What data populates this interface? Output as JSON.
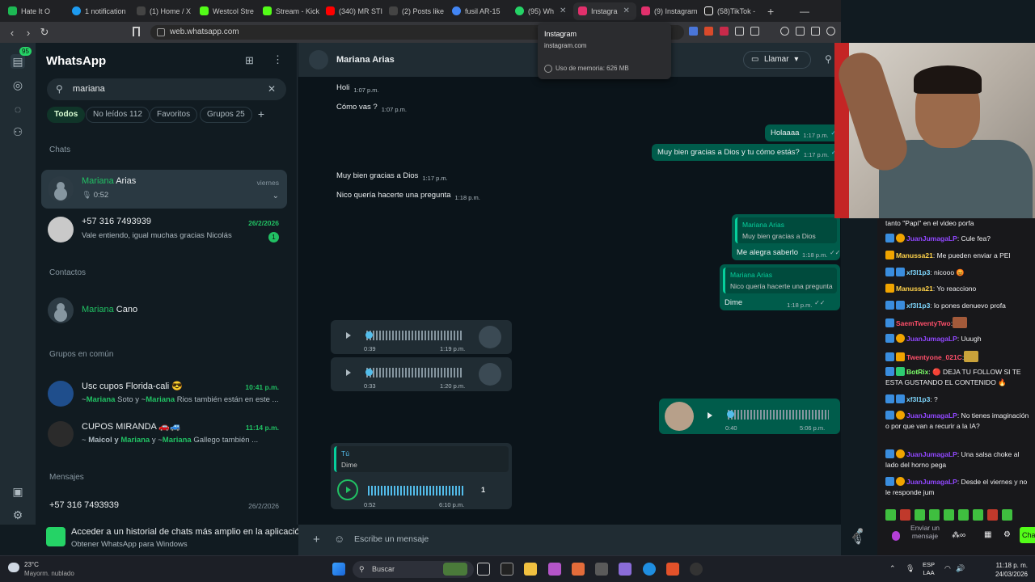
{
  "browser": {
    "tabs": [
      {
        "label": "Hate It O",
        "color": "#1db954"
      },
      {
        "label": "1 notification",
        "color": "#1d9bf0"
      },
      {
        "label": "(1) Home / X",
        "color": "#555555"
      },
      {
        "label": "Westcol Stre",
        "color": "#53fc18"
      },
      {
        "label": "Stream - Kick",
        "color": "#53fc18"
      },
      {
        "label": "(340) MR STI",
        "color": "#ff0000"
      },
      {
        "label": "(2) Posts like",
        "color": "#555555"
      },
      {
        "label": "fusil AR-15",
        "color": "#4285f4"
      },
      {
        "label": "(95) Wh",
        "color": "#25d366"
      },
      {
        "label": "Instagra",
        "color": "#e1306c"
      },
      {
        "label": "(9) Instagram",
        "color": "#e1306c"
      },
      {
        "label": "(58)TikTok -",
        "color": "#ffffff"
      }
    ],
    "url": "web.whatsapp.com",
    "tooltip": {
      "title": "Instagram",
      "domain": "instagram.com",
      "memory": "Uso de memoria: 626 MB"
    }
  },
  "wa": {
    "title": "WhatsApp",
    "notif_count": "95",
    "search_value": "mariana",
    "filters": {
      "all": "Todos",
      "unread": "No leídos",
      "unread_count": "112",
      "fav": "Favoritos",
      "groups": "Grupos",
      "groups_count": "25"
    },
    "sections": {
      "chats": "Chats",
      "contacts": "Contactos",
      "groups": "Grupos en común",
      "messages": "Mensajes"
    },
    "chats": [
      {
        "name_hl": "Mariana",
        "name_rest": " Arias",
        "sub": "0:52",
        "time": "viernes"
      },
      {
        "name": "+57 316 7493939",
        "sub": "Vale entiendo, igual muchas gracias Nicolás",
        "time": "26/2/2026",
        "unread": "1"
      }
    ],
    "contact": {
      "name_hl": "Mariana",
      "name_rest": " Cano"
    },
    "groups": [
      {
        "name": "Usc cupos Florida-cali 😎",
        "time": "10:41 p.m.",
        "sub_a": "~",
        "sub_b": "Mariana",
        "sub_c": " Soto y ~",
        "sub_d": "Mariana",
        "sub_e": " Rios también están en este ..."
      },
      {
        "name": "CUPOS MIRANDA 🚗🚙",
        "time": "11:14 p.m.",
        "sub_a": "~ ",
        "sub_b": "Maicol y ",
        "sub_c": "Mariana",
        "sub_d": " y ~",
        "sub_e": "Mariana",
        "sub_f": " Gallego también ..."
      }
    ],
    "message_row": {
      "name": "+57 316 7493939",
      "time": "26/2/2026"
    },
    "promo": {
      "line1": "Acceder a un historial de chats más amplio en la aplicación",
      "line2": "Obtener WhatsApp para Windows"
    },
    "conv": {
      "name": "Mariana Arias",
      "call": "Llamar",
      "composer_placeholder": "Escribe un mensaje",
      "messages": [
        {
          "text": "Holi",
          "time": "1:07 p.m."
        },
        {
          "text": "Cómo vas ?",
          "time": "1:07 p.m."
        },
        {
          "text": "Holaaaa",
          "time": "1:17 p.m."
        },
        {
          "text": "Muy bien gracias a Dios y tu cómo estás?",
          "time": "1:17 p.m."
        },
        {
          "text": "Muy bien gracias a Dios",
          "time": "1:17 p.m."
        },
        {
          "text": "Nico quería hacerte una pregunta",
          "time": "1:18 p.m."
        },
        {
          "quote_name": "Mariana Arias",
          "quote_text": "Muy bien gracias a Dios",
          "text": "Me alegra saberlo",
          "time": "1:18 p.m."
        },
        {
          "quote_name": "Mariana Arias",
          "quote_text": "Nico quería hacerte una pregunta",
          "text": "Dime",
          "time": "1:18 p.m."
        }
      ],
      "voice": [
        {
          "duration": "0:39",
          "time": "1:19 p.m."
        },
        {
          "duration": "0:33",
          "time": "1:20 p.m."
        },
        {
          "duration": "0:40",
          "time": "5:06 p.m."
        },
        {
          "quote_name": "Tú",
          "quote_text": "Dime",
          "duration": "0:52",
          "time": "6:10 p.m.",
          "speed": "1"
        }
      ]
    }
  },
  "twitch": {
    "lines": [
      {
        "user": "",
        "text": "tanto \"Papi\" en el video porfa"
      },
      {
        "user": "JuanJumagaLP",
        "text": ": Cule fea?",
        "color": "#9147ff"
      },
      {
        "user": "Manussa21",
        "text": ": Me pueden enviar a PEI",
        "color": "#ffd24a"
      },
      {
        "user": "xf3l1p3",
        "text": ": nicooo 😡",
        "color": "#7fd8ff"
      },
      {
        "user": "Manussa21",
        "text": ": Yo reacciono",
        "color": "#ffd24a"
      },
      {
        "user": "xf3l1p3",
        "text": ": lo pones denuevo profa",
        "color": "#7fd8ff"
      },
      {
        "user": "SaemTwentyTwo",
        "text": ":",
        "color": "#ff4f6a"
      },
      {
        "user": "JuanJumagaLP",
        "text": ": Uuugh",
        "color": "#9147ff"
      },
      {
        "user": "Twentyone_021C",
        "text": ":",
        "color": "#ff4f6a"
      },
      {
        "user": "BotRix",
        "text": ": 🔴 DEJA TU FOLLOW SI TE ESTA GUSTANDO EL CONTENIDO 🔥",
        "color": "#7cff6a"
      },
      {
        "user": "xf3l1p3",
        "text": ": ?",
        "color": "#7fd8ff"
      },
      {
        "user": "JuanJumagaLP",
        "text": ": No tienes imaginación o por que van a recurir a la IA?",
        "color": "#9147ff"
      },
      {
        "user": "JuanJumagaLP",
        "text": ": Una salsa choke al lado del horno pega",
        "color": "#9147ff"
      },
      {
        "user": "JuanJumagaLP",
        "text": ": Desde el viernes y no le responde jum",
        "color": "#9147ff"
      }
    ],
    "input_placeholder": "Enviar un mensaje",
    "chat_button": "Cha"
  },
  "taskbar": {
    "temp": "23°C",
    "weather": "Mayorm. nublado",
    "search": "Buscar",
    "lang1": "ESP",
    "lang2": "LAA",
    "time": "11:18 p. m.",
    "date": "24/03/2026"
  }
}
